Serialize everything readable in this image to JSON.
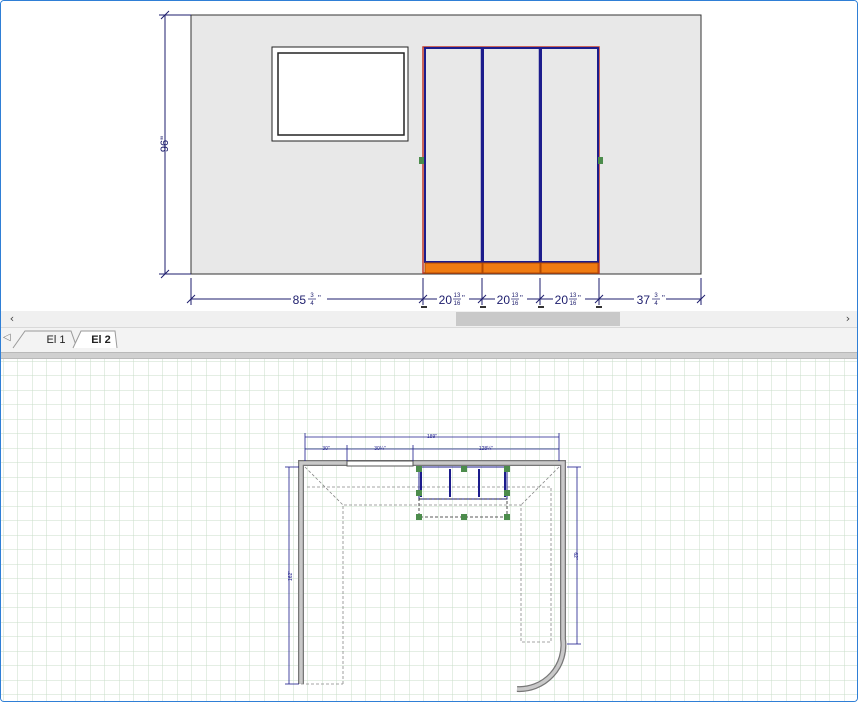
{
  "elevation": {
    "height_dim": "96\"",
    "dims": [
      {
        "whole": "85",
        "num": "3",
        "den": "4"
      },
      {
        "whole": "20",
        "num": "13",
        "den": "16"
      },
      {
        "whole": "20",
        "num": "13",
        "den": "16"
      },
      {
        "whole": "20",
        "num": "13",
        "den": "16"
      },
      {
        "whole": "37",
        "num": "3",
        "den": "4"
      }
    ]
  },
  "tabs": [
    {
      "label": "El 1",
      "active": false
    },
    {
      "label": "El 2",
      "active": true
    }
  ],
  "plan": {
    "dim_top_overall": "189\"",
    "dim_top_seg1": "30\"",
    "dim_top_seg2": "30¼\"",
    "dim_top_seg3": "128¼\"",
    "dim_left": "162\"",
    "dim_right": "62\""
  },
  "colors": {
    "accent_blue": "#2f7fd6",
    "cabinet_outline": "#1c1c8c",
    "toe_kick": "#f07b12",
    "grid": "#c8dec8",
    "wall": "#e8e8e8"
  }
}
